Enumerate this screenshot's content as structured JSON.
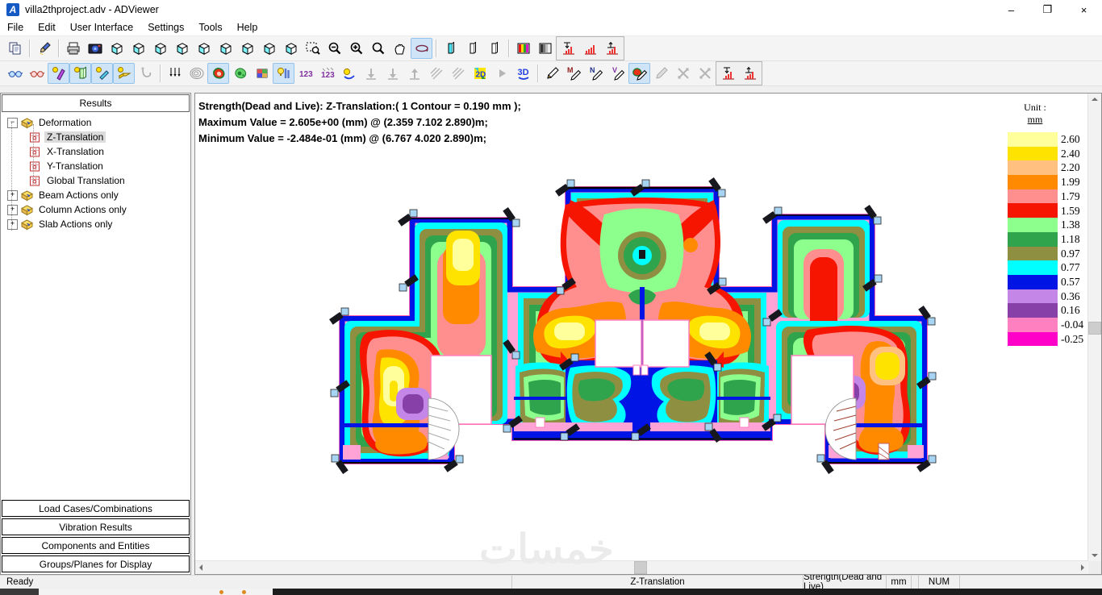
{
  "window": {
    "title": "villa2thproject.adv - ADViewer",
    "app_icon_letter": "A",
    "controls": [
      {
        "name": "minimize",
        "glyph": "–"
      },
      {
        "name": "restore",
        "glyph": "❐"
      },
      {
        "name": "close",
        "glyph": "×"
      }
    ]
  },
  "menu": {
    "items": [
      "File",
      "Edit",
      "User Interface",
      "Settings",
      "Tools",
      "Help"
    ]
  },
  "toolbar_row1": [
    {
      "n": "copy-button",
      "s": "i-copy",
      "st": "normal"
    },
    "|",
    {
      "n": "format-painter-button",
      "s": "i-brush",
      "st": "normal"
    },
    "|",
    {
      "n": "print-button",
      "s": "i-print",
      "st": "normal"
    },
    {
      "n": "snapshot-button",
      "s": "i-camera",
      "st": "normal"
    },
    {
      "n": "view-cube-front-button",
      "s": "i-cube",
      "st": "normal"
    },
    {
      "n": "view-cube-back-button",
      "s": "i-cube",
      "st": "normal"
    },
    {
      "n": "view-cube-left-button",
      "s": "i-cube",
      "st": "normal"
    },
    {
      "n": "view-cube-right-button",
      "s": "i-cube",
      "st": "normal"
    },
    {
      "n": "view-cube-top-button",
      "s": "i-cube",
      "st": "normal"
    },
    {
      "n": "view-cube-bottom-button",
      "s": "i-cube",
      "st": "normal"
    },
    {
      "n": "view-cube-iso-ne-button",
      "s": "i-cube",
      "st": "normal"
    },
    {
      "n": "view-cube-iso-nw-button",
      "s": "i-cube",
      "st": "normal"
    },
    {
      "n": "view-cube-iso-se-button",
      "s": "i-cube",
      "st": "normal"
    },
    {
      "n": "zoom-window-button",
      "s": "i-magrect",
      "st": "normal"
    },
    {
      "n": "zoom-out-button",
      "s": "i-magminus",
      "st": "normal"
    },
    {
      "n": "zoom-in-button",
      "s": "i-magplus",
      "st": "normal"
    },
    {
      "n": "zoom-extents-button",
      "s": "i-mag",
      "st": "normal"
    },
    {
      "n": "pan-button",
      "s": "i-hand",
      "st": "normal"
    },
    {
      "n": "orbit-button",
      "s": "i-orbit",
      "st": "active"
    },
    "|",
    {
      "n": "slice-near-button",
      "s": "i-prism1",
      "st": "normal"
    },
    {
      "n": "slice-mid-button",
      "s": "i-prism2",
      "st": "normal"
    },
    {
      "n": "slice-far-button",
      "s": "i-prism2",
      "st": "normal"
    },
    "|",
    {
      "n": "color-scale-button",
      "s": "i-colorbars",
      "st": "normal"
    },
    {
      "n": "gray-scale-button",
      "s": "i-graybars",
      "st": "normal"
    },
    "GRP",
    {
      "n": "result-min-chart-button",
      "s": "i-chartdn",
      "st": "normal"
    },
    {
      "n": "result-chart-button",
      "s": "i-chart",
      "st": "normal"
    },
    {
      "n": "result-max-chart-button",
      "s": "i-chartup",
      "st": "normal"
    }
  ],
  "toolbar_row2": [
    {
      "n": "wireframe-glasses-button",
      "s": "i-glasses",
      "st": "normal"
    },
    {
      "n": "render-glasses-button",
      "s": "i-glasses2",
      "st": "normal"
    },
    {
      "n": "show-columns-toggle",
      "s": "i-colel",
      "st": "active"
    },
    {
      "n": "show-walls-toggle",
      "s": "i-wallel",
      "st": "active"
    },
    {
      "n": "show-beams-toggle",
      "s": "i-beamel",
      "st": "active"
    },
    {
      "n": "show-slabs-toggle",
      "s": "i-slabel",
      "st": "active"
    },
    {
      "n": "hook-button",
      "s": "i-hook",
      "st": "disabled"
    },
    "|",
    {
      "n": "load-arrows-button",
      "s": "i-arrs",
      "st": "normal"
    },
    {
      "n": "contour-lines-button",
      "s": "i-contl",
      "st": "normal"
    },
    {
      "n": "contour-filled-toggle",
      "s": "i-contr",
      "st": "active"
    },
    {
      "n": "contour-zones-button",
      "s": "i-contg",
      "st": "normal"
    },
    {
      "n": "patch-colors-button",
      "s": "i-mosaic",
      "st": "normal"
    },
    {
      "n": "show-values-toggle",
      "s": "i-bulbbars",
      "st": "active"
    },
    {
      "n": "numbers-button",
      "s": "i-123",
      "st": "normal"
    },
    {
      "n": "numbers-off-button",
      "s": "i-123d",
      "st": "normal"
    },
    {
      "n": "smooth-results-button",
      "s": "i-ball",
      "st": "normal"
    },
    {
      "n": "lower-values-button",
      "s": "i-darr",
      "st": "disabled"
    },
    {
      "n": "drop-values-button",
      "s": "i-darr",
      "st": "disabled"
    },
    {
      "n": "raise-values-button",
      "s": "i-uarr",
      "st": "disabled"
    },
    {
      "n": "hatch-a-button",
      "s": "i-hatch",
      "st": "disabled"
    },
    {
      "n": "hatch-b-button",
      "s": "i-hatch",
      "st": "disabled"
    },
    {
      "n": "view-2d-button",
      "s": "i-2d",
      "st": "normal"
    },
    {
      "n": "step-button",
      "s": "i-play",
      "st": "disabled"
    },
    {
      "n": "view-3d-button",
      "s": "i-3d",
      "st": "normal"
    },
    "|",
    {
      "n": "draw-deformation-button",
      "s": "i-pencil",
      "st": "normal"
    },
    {
      "n": "draw-moment-button",
      "s": "i-pencM",
      "st": "normal"
    },
    {
      "n": "draw-normal-button",
      "s": "i-pencN",
      "st": "normal"
    },
    {
      "n": "draw-shear-button",
      "s": "i-pencV",
      "st": "normal"
    },
    {
      "n": "draw-contour-toggle",
      "s": "i-pencC",
      "st": "active"
    },
    {
      "n": "draw-off-button",
      "s": "i-pencG",
      "st": "disabled"
    },
    {
      "n": "flip-a-button",
      "s": "i-xgray",
      "st": "disabled"
    },
    {
      "n": "flip-b-button",
      "s": "i-xgray",
      "st": "disabled"
    },
    "GRP",
    {
      "n": "diagram-min-button",
      "s": "i-chartdn",
      "st": "normal"
    },
    {
      "n": "diagram-max-button",
      "s": "i-chartup",
      "st": "normal"
    }
  ],
  "sidebar": {
    "header": "Results",
    "tree": [
      {
        "label": "Deformation",
        "level": 0,
        "expander": "minus",
        "icon": "box",
        "selected": false
      },
      {
        "label": "Z-Translation",
        "level": 1,
        "expander": "",
        "icon": "sheet",
        "selected": true
      },
      {
        "label": "X-Translation",
        "level": 1,
        "expander": "",
        "icon": "sheet",
        "selected": false
      },
      {
        "label": "Y-Translation",
        "level": 1,
        "expander": "",
        "icon": "sheet",
        "selected": false
      },
      {
        "label": "Global Translation",
        "level": 1,
        "expander": "",
        "icon": "sheet",
        "selected": false
      },
      {
        "label": "Beam Actions only",
        "level": 0,
        "expander": "plus",
        "icon": "box",
        "selected": false
      },
      {
        "label": "Column Actions only",
        "level": 0,
        "expander": "plus",
        "icon": "box",
        "selected": false
      },
      {
        "label": "Slab Actions only",
        "level": 0,
        "expander": "plus",
        "icon": "box",
        "selected": false
      }
    ],
    "bottom_buttons": [
      "Load Cases/Combinations",
      "Vibration Results",
      "Components and Entities",
      "Groups/Planes for Display"
    ]
  },
  "canvas": {
    "header_lines": [
      "Strength(Dead and Live): Z-Translation:( 1 Contour = 0.190 mm );",
      "Maximum Value = 2.605e+00 (mm) @ (2.359 7.102 2.890)m;",
      "Minimum Value = -2.484e-01 (mm) @ (6.767 4.020 2.890)m;"
    ],
    "contour_interval_mm": "0.190",
    "maximum": {
      "value_mm": "2.605e+00",
      "at_m": "(2.359 7.102 2.890)"
    },
    "minimum": {
      "value_mm": "-2.484e-01",
      "at_m": "(6.767 4.020 2.890)"
    },
    "watermark": "خمسات"
  },
  "legend": {
    "title": "Unit :",
    "unit": "mm",
    "entries": [
      {
        "value": "2.60",
        "color": "#FFFF9C"
      },
      {
        "value": "2.40",
        "color": "#FFE300"
      },
      {
        "value": "2.20",
        "color": "#FFC080"
      },
      {
        "value": "1.99",
        "color": "#FF8A00"
      },
      {
        "value": "1.79",
        "color": "#FF8F8F"
      },
      {
        "value": "1.59",
        "color": "#F51500"
      },
      {
        "value": "1.38",
        "color": "#8DFF8D"
      },
      {
        "value": "1.18",
        "color": "#2FA44C"
      },
      {
        "value": "0.97",
        "color": "#8F8F42"
      },
      {
        "value": "0.77",
        "color": "#00FFFF"
      },
      {
        "value": "0.57",
        "color": "#0014E6"
      },
      {
        "value": "0.36",
        "color": "#C487E8"
      },
      {
        "value": "0.16",
        "color": "#8740A8"
      },
      {
        "value": "-0.04",
        "color": "#FF80C0"
      },
      {
        "value": "-0.25",
        "color": "#FF00C8"
      }
    ]
  },
  "statusbar": {
    "ready": "Ready",
    "result_component": "Z-Translation",
    "load_case": "Strength(Dead and Live)",
    "unit": "mm",
    "num_lock": "NUM"
  }
}
